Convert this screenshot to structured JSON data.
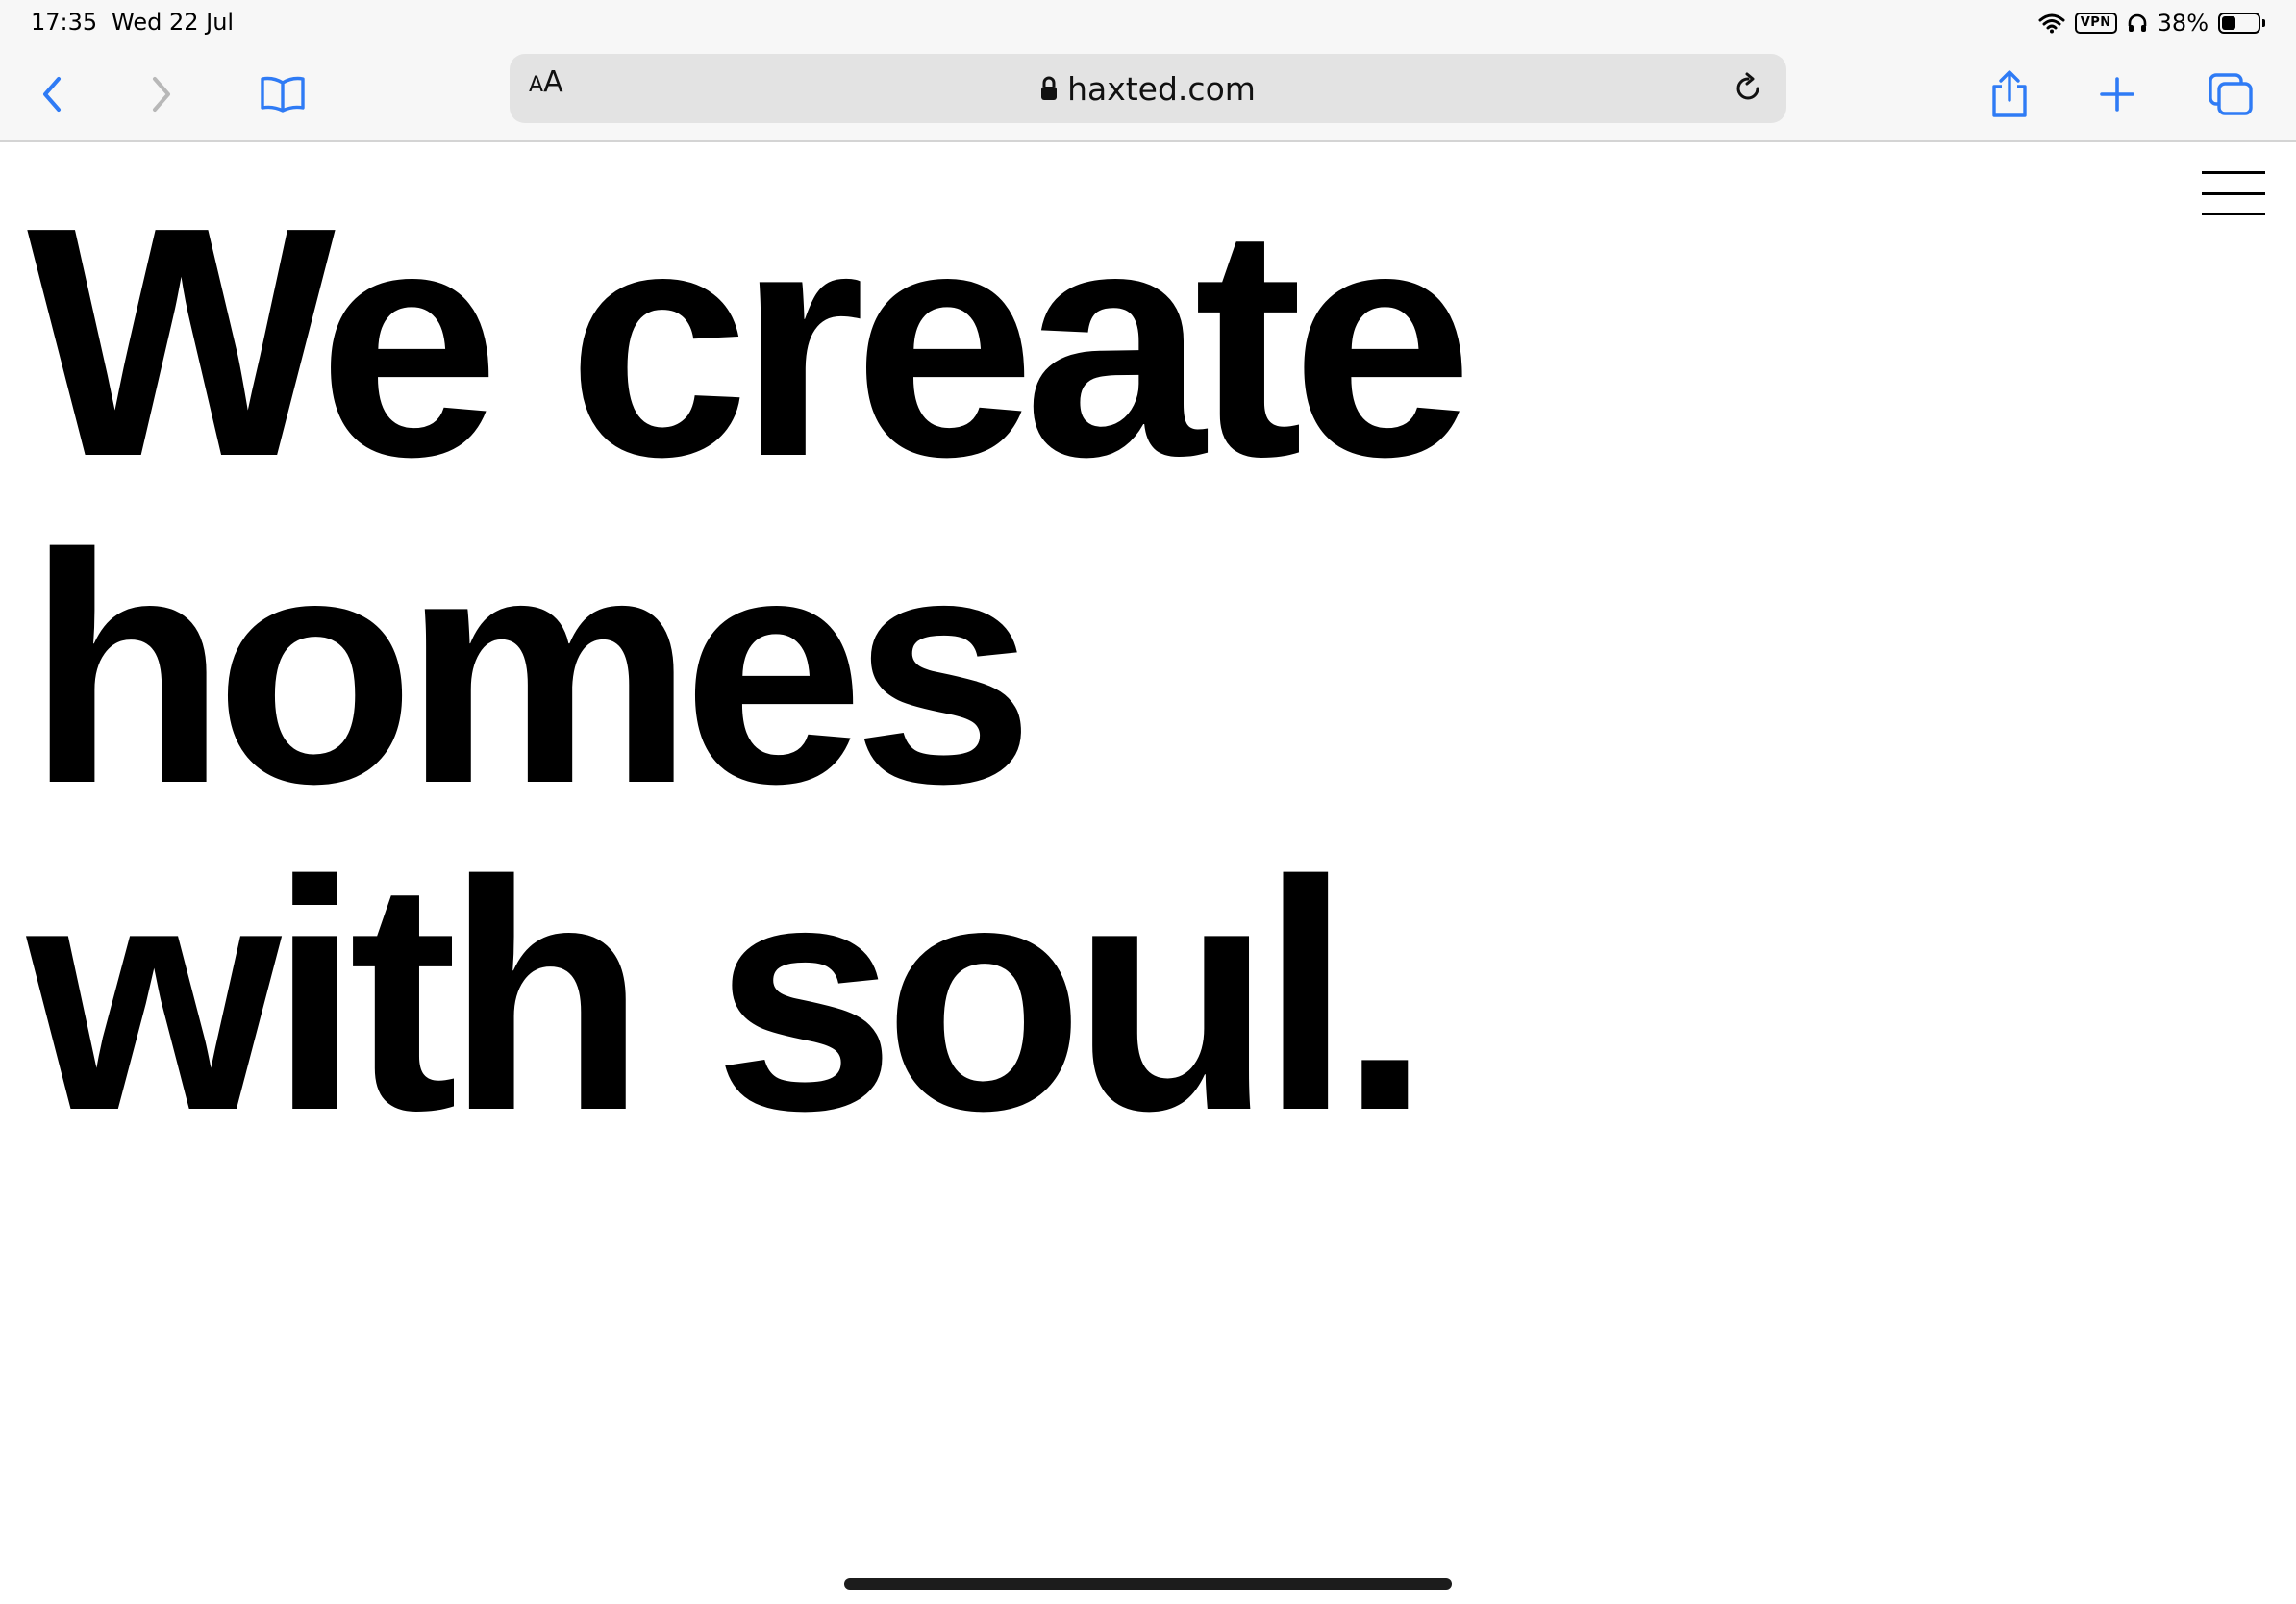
{
  "status_bar": {
    "time": "17:35",
    "date": "Wed 22 Jul",
    "vpn": "VPN",
    "battery": "38%",
    "battery_level": 0.38,
    "icons": [
      "wifi-icon",
      "headphones-icon",
      "battery-icon"
    ]
  },
  "browser": {
    "text_size_small": "A",
    "text_size_large": "A",
    "url": "haxted.com",
    "accent_color": "#2f7bf5",
    "buttons": [
      "back-button",
      "forward-button",
      "bookmarks-button",
      "reload-button",
      "share-button",
      "new-tab-button",
      "tabs-button"
    ]
  },
  "page": {
    "headline_lines": [
      "We create",
      "homes",
      "with soul."
    ]
  }
}
